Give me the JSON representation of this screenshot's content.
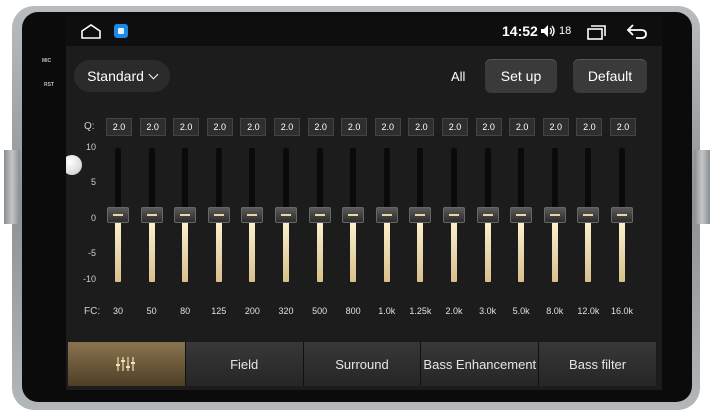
{
  "device": {
    "side_labels": [
      "MIC",
      "RST"
    ]
  },
  "statusbar": {
    "time": "14:52",
    "volume_level": "18",
    "icons": [
      "home-icon",
      "app-icon",
      "volume-icon",
      "recents-icon",
      "back-icon"
    ]
  },
  "toolbar": {
    "preset_label": "Standard",
    "all_label": "All",
    "setup_label": "Set up",
    "default_label": "Default"
  },
  "equalizer": {
    "q_label": "Q:",
    "fc_label": "FC:",
    "scale": [
      "10",
      "5",
      "0",
      "-5",
      "-10"
    ],
    "range": [
      -10,
      10
    ],
    "bands": [
      {
        "fc": "30",
        "q": "2.0",
        "gain": 0
      },
      {
        "fc": "50",
        "q": "2.0",
        "gain": 0
      },
      {
        "fc": "80",
        "q": "2.0",
        "gain": 0
      },
      {
        "fc": "125",
        "q": "2.0",
        "gain": 0
      },
      {
        "fc": "200",
        "q": "2.0",
        "gain": 0
      },
      {
        "fc": "320",
        "q": "2.0",
        "gain": 0
      },
      {
        "fc": "500",
        "q": "2.0",
        "gain": 0
      },
      {
        "fc": "800",
        "q": "2.0",
        "gain": 0
      },
      {
        "fc": "1.0k",
        "q": "2.0",
        "gain": 0
      },
      {
        "fc": "1.25k",
        "q": "2.0",
        "gain": 0
      },
      {
        "fc": "2.0k",
        "q": "2.0",
        "gain": 0
      },
      {
        "fc": "3.0k",
        "q": "2.0",
        "gain": 0
      },
      {
        "fc": "5.0k",
        "q": "2.0",
        "gain": 0
      },
      {
        "fc": "8.0k",
        "q": "2.0",
        "gain": 0
      },
      {
        "fc": "12.0k",
        "q": "2.0",
        "gain": 0
      },
      {
        "fc": "16.0k",
        "q": "2.0",
        "gain": 0
      }
    ]
  },
  "tabs": [
    {
      "label": "",
      "icon": "equalizer-icon",
      "active": true
    },
    {
      "label": "Field",
      "active": false
    },
    {
      "label": "Surround",
      "active": false
    },
    {
      "label": "Bass Enhancement",
      "active": false
    },
    {
      "label": "Bass filter",
      "active": false
    }
  ],
  "colors": {
    "accent": "#8a7450",
    "slider_fill": "#e8d5a0",
    "background": "#1c1c1c"
  }
}
